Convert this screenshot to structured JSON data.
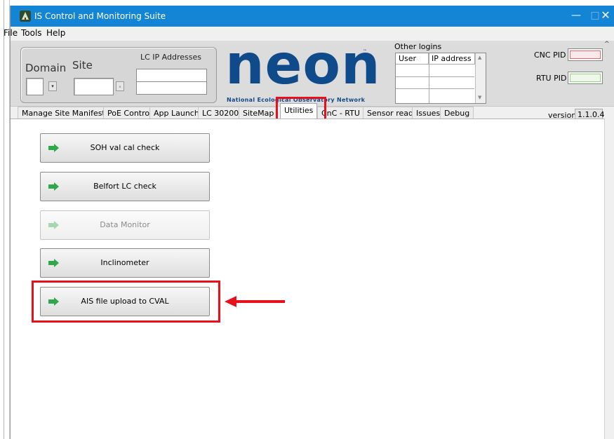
{
  "window": {
    "title": "IS Control and Monitoring Suite",
    "controls": {
      "minimize": "—",
      "maximize": "□",
      "close": "✕"
    }
  },
  "menu": [
    "File",
    "Tools",
    "Help"
  ],
  "header": {
    "domain_label": "Domain",
    "site_label": "Site",
    "lc_ip_label": "LC IP Addresses",
    "logo": {
      "word": "neon",
      "tm": "™",
      "subtitle": "National Ecological Observatory Network"
    },
    "other_logins": {
      "label": "Other logins",
      "columns": [
        "User",
        "IP address"
      ]
    },
    "cnc_pid_label": "CNC PID",
    "rtu_pid_label": "RTU PID",
    "cnc_pid_color": "#e06a6a",
    "rtu_pid_color": "#9ad08a",
    "version_label": "version",
    "version_value": "1.1.0.4"
  },
  "tabs": [
    {
      "label": "Manage Site Manifest"
    },
    {
      "label": "PoE Control"
    },
    {
      "label": "App Launcher"
    },
    {
      "label": "LC 30200"
    },
    {
      "label": "SiteMap"
    },
    {
      "label": "Utilities",
      "active": true
    },
    {
      "label": "CnC - RTU"
    },
    {
      "label": "Sensor read"
    },
    {
      "label": "Issues"
    },
    {
      "label": "Debug"
    }
  ],
  "utilities": [
    {
      "label": "SOH val cal check",
      "enabled": true
    },
    {
      "label": "Belfort LC check",
      "enabled": true
    },
    {
      "label": "Data Monitor",
      "enabled": false
    },
    {
      "label": "Inclinometer",
      "enabled": true
    },
    {
      "label": "AIS file upload to CVAL",
      "enabled": true,
      "highlighted": true
    }
  ],
  "colors": {
    "titlebar": "#1484d4",
    "highlight": "#e8101a",
    "arrow_green": "#2fa84a",
    "logo": "#0f4a8a"
  }
}
